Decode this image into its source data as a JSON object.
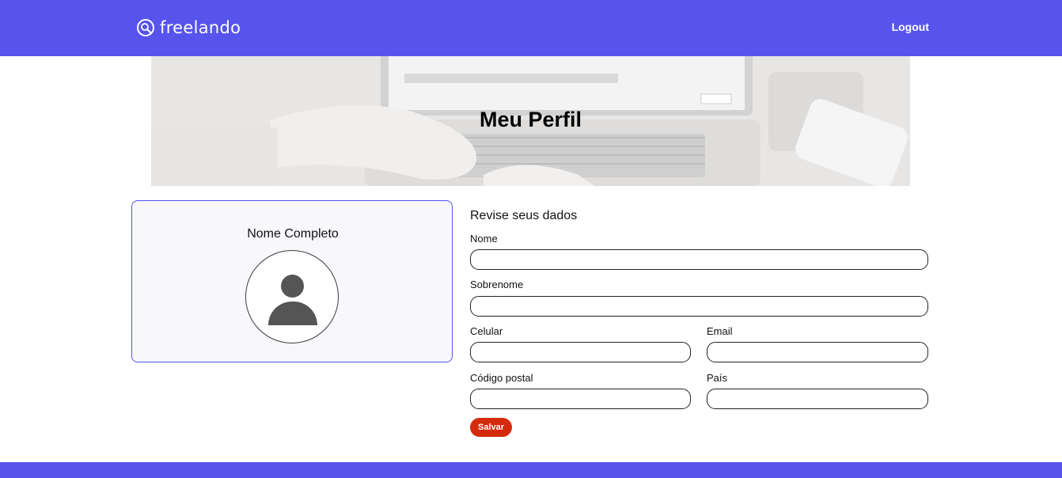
{
  "header": {
    "brand": "freelando",
    "logout_label": "Logout"
  },
  "banner": {
    "title": "Meu Perfil"
  },
  "profile_card": {
    "name": "Nome Completo",
    "avatar_icon": "user-avatar-icon"
  },
  "form": {
    "title": "Revise seus dados",
    "fields": {
      "nome": {
        "label": "Nome",
        "value": ""
      },
      "sobrenome": {
        "label": "Sobrenome",
        "value": ""
      },
      "celular": {
        "label": "Celular",
        "value": ""
      },
      "email": {
        "label": "Email",
        "value": ""
      },
      "codigo_postal": {
        "label": "Código postal",
        "value": ""
      },
      "pais": {
        "label": "País",
        "value": ""
      }
    },
    "save_label": "Salvar"
  },
  "colors": {
    "brand": "#5754ed",
    "save_button": "#d42b0c",
    "card_background": "#f7f7fc"
  }
}
